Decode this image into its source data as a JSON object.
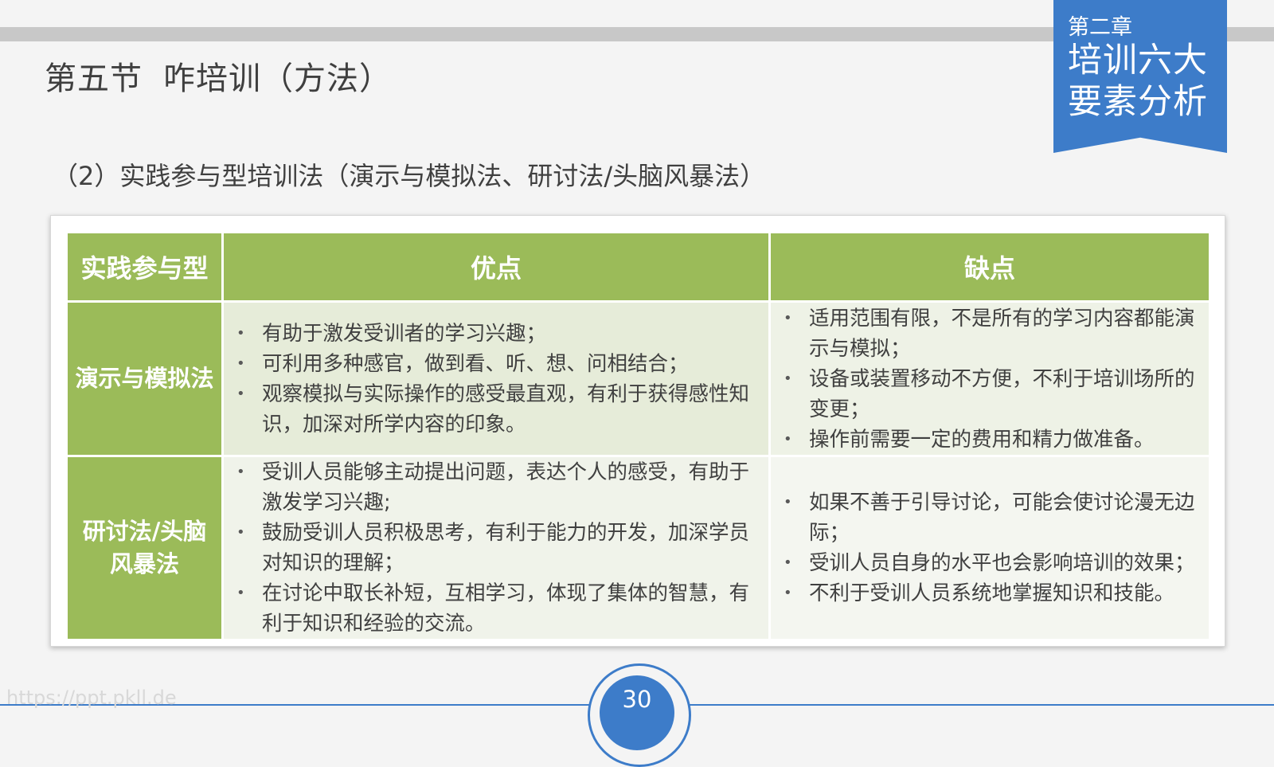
{
  "section": {
    "title_part1": "第五节",
    "title_part2": "咋培训（方法）"
  },
  "chapter": {
    "label": "第二章",
    "title": "培训六大要素分析"
  },
  "subtitle": "（2）实践参与型培训法（演示与模拟法、研讨法/头脑风暴法）",
  "table": {
    "headers": [
      "实践参与型",
      "优点",
      "缺点"
    ],
    "rows": [
      {
        "name": "演示与模拟法",
        "pros": [
          "有助于激发受训者的学习兴趣；",
          "可利用多种感官，做到看、听、想、问相结合；",
          "观察模拟与实际操作的感受最直观，有利于获得感性知识，加深对所学内容的印象。"
        ],
        "cons": [
          "适用范围有限，不是所有的学习内容都能演示与模拟；",
          "设备或装置移动不方便，不利于培训场所的变更；",
          "操作前需要一定的费用和精力做准备。"
        ]
      },
      {
        "name_line1": "研讨法/头脑",
        "name_line2": "风暴法",
        "pros": [
          "受训人员能够主动提出问题，表达个人的感受，有助于激发学习兴趣;",
          "鼓励受训人员积极思考，有利于能力的开发，加深学员对知识的理解；",
          "在讨论中取长补短，互相学习，体现了集体的智慧，有利于知识和经验的交流。"
        ],
        "cons": [
          "如果不善于引导讨论，可能会使讨论漫无边际；",
          "受训人员自身的水平也会影响培训的效果；",
          "不利于受训人员系统地掌握知识和技能。"
        ]
      }
    ]
  },
  "page_number": "30",
  "watermark": "https://ppt.pkll.de",
  "colors": {
    "accent_blue": "#3d7cc9",
    "header_green": "#9bbb59",
    "cell_green": "#e6ecd9"
  }
}
